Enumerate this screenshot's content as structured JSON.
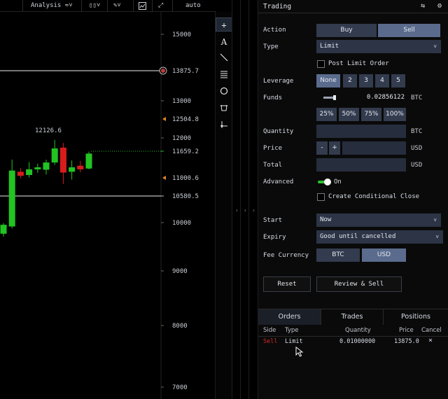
{
  "chart_toolbar": {
    "analysis_label": "Analysis",
    "auto_label": "auto"
  },
  "chart_data": {
    "type": "candlestick",
    "y_ticks": [
      15000,
      13000,
      12000,
      10000,
      9000,
      8000,
      7000
    ],
    "price_lines": [
      {
        "value": 13875.7,
        "label": "13875.7",
        "color": "#bcbcbc",
        "style": "solid",
        "marker": "circle"
      },
      {
        "value": 12504.8,
        "label": "12504.8",
        "color": "#c8ccd4",
        "marker": "orange-arrow"
      },
      {
        "value": 11659.2,
        "label": "11659.2",
        "color": "#2db82d",
        "style": "dotted"
      },
      {
        "value": 11000.6,
        "label": "11000.6",
        "color": "#c8ccd4",
        "marker": "orange-arrow"
      },
      {
        "value": 10580.5,
        "label": "10580.5",
        "color": "#bcbcbc",
        "style": "solid"
      }
    ],
    "annotation": {
      "text": "12126.6"
    },
    "candles": [
      {
        "o": 9770,
        "h": 9990,
        "l": 9710,
        "c": 9955
      },
      {
        "o": 9920,
        "h": 11450,
        "l": 9880,
        "c": 11180
      },
      {
        "o": 11150,
        "h": 11240,
        "l": 10990,
        "c": 11050
      },
      {
        "o": 11070,
        "h": 11390,
        "l": 11010,
        "c": 11210
      },
      {
        "o": 11210,
        "h": 11350,
        "l": 11120,
        "c": 11260
      },
      {
        "o": 11200,
        "h": 11450,
        "l": 11080,
        "c": 11380
      },
      {
        "o": 11380,
        "h": 11950,
        "l": 11320,
        "c": 11730
      },
      {
        "o": 11750,
        "h": 11870,
        "l": 10860,
        "c": 11130
      },
      {
        "o": 11150,
        "h": 11430,
        "l": 10960,
        "c": 11260
      },
      {
        "o": 11300,
        "h": 11420,
        "l": 11140,
        "c": 11210
      },
      {
        "o": 11230,
        "h": 11650,
        "l": 11210,
        "c": 11600
      }
    ]
  },
  "trading": {
    "title": "Trading",
    "action_label": "Action",
    "buy_label": "Buy",
    "sell_label": "Sell",
    "type_label": "Type",
    "type_value": "Limit",
    "post_limit_label": "Post Limit Order",
    "leverage_label": "Leverage",
    "leverage_options": [
      "None",
      "2",
      "3",
      "4",
      "5"
    ],
    "funds_label": "Funds",
    "funds_value": "0.02856122",
    "funds_unit": "BTC",
    "funds_fraction": 0.08,
    "percent_options": [
      "25%",
      "50%",
      "75%",
      "100%"
    ],
    "quantity_label": "Quantity",
    "quantity_unit": "BTC",
    "price_label": "Price",
    "price_minus": "-",
    "price_plus": "+",
    "price_unit": "USD",
    "total_label": "Total",
    "total_unit": "USD",
    "advanced_label": "Advanced",
    "advanced_state": "On",
    "conditional_close_label": "Create Conditional Close",
    "start_label": "Start",
    "start_value": "Now",
    "expiry_label": "Expiry",
    "expiry_value": "Good until cancelled",
    "fee_currency_label": "Fee Currency",
    "fee_options": [
      "BTC",
      "USD"
    ],
    "reset_label": "Reset",
    "review_label": "Review & Sell"
  },
  "orders": {
    "tabs": [
      "Orders",
      "Trades",
      "Positions"
    ],
    "columns": [
      "Side",
      "Type",
      "Quantity",
      "Price",
      "Cancel"
    ],
    "rows": [
      {
        "side": "Sell",
        "type": "Limit",
        "quantity": "0.01000000",
        "price": "13875.0",
        "cancel": "×"
      }
    ]
  },
  "colors": {
    "up": "#22c322",
    "down": "#d81c1c",
    "sell_text": "#d42a2a",
    "accent_button": "#5a6b8d"
  }
}
